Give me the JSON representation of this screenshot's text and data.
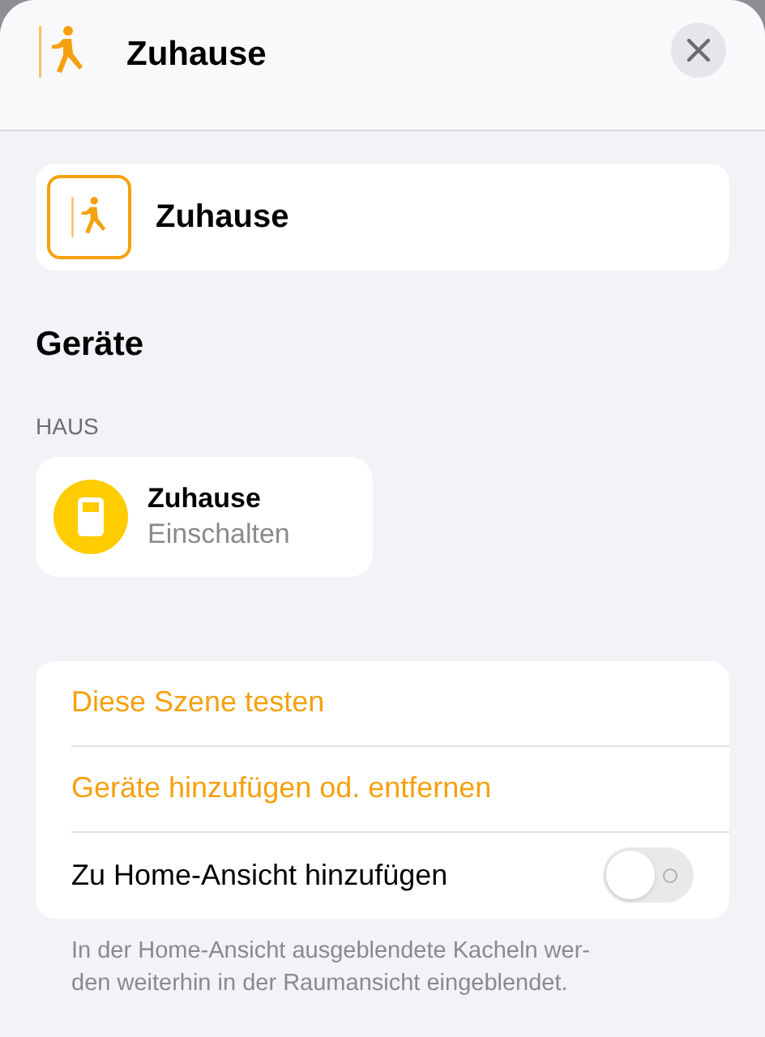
{
  "header": {
    "title": "Zuhause"
  },
  "scene": {
    "name": "Zuhause"
  },
  "devices": {
    "heading": "Geräte",
    "section": "HAUS",
    "tiles": [
      {
        "name": "Zuhause",
        "status": "Einschalten"
      }
    ]
  },
  "actions": [
    {
      "kind": "action",
      "label": "Diese Szene testen"
    },
    {
      "kind": "action",
      "label": "Geräte hinzufügen od. entfernen"
    },
    {
      "kind": "toggle",
      "label": "Zu Home-Ansicht hinzufügen",
      "on": false
    }
  ],
  "footer": "In der Home-Ansicht ausgeblendete Kacheln wer-\nden weiterhin in der Raumansicht eingeblendet."
}
